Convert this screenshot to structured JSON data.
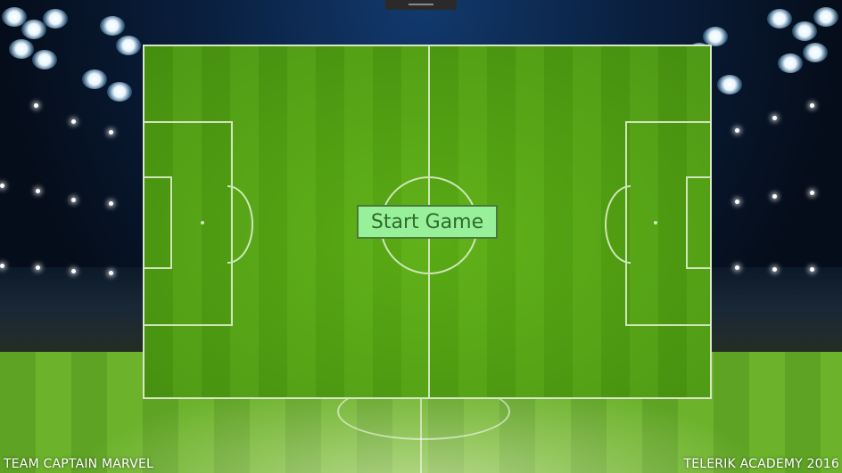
{
  "menu": {
    "start_label": "Start Game"
  },
  "footer": {
    "left_text": "TEAM CAPTAIN MARVEL",
    "right_text": "TELERIK ACADEMY 2016"
  },
  "colors": {
    "button_bg": "#98f09a",
    "button_text": "#2f6b2a",
    "pitch_green": "#4a9a10",
    "line_white": "#cfe6b8"
  }
}
